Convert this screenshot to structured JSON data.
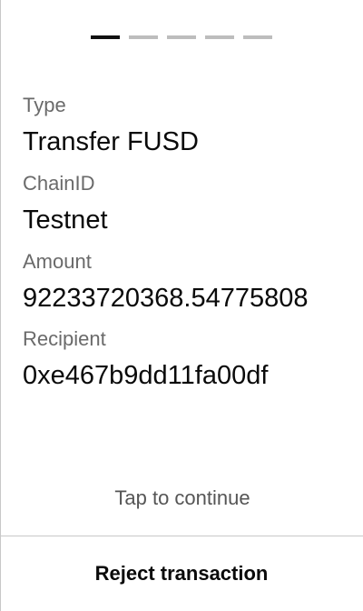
{
  "pager": {
    "total_steps": 5,
    "active_step": 1
  },
  "fields": {
    "type": {
      "label": "Type",
      "value": "Transfer FUSD"
    },
    "chain": {
      "label": "ChainID",
      "value": "Testnet"
    },
    "amount": {
      "label": "Amount",
      "value": "92233720368.54775808"
    },
    "recipient": {
      "label": "Recipient",
      "value": "0xe467b9dd11fa00df"
    }
  },
  "hint": "Tap to continue",
  "actions": {
    "reject_label": "Reject transaction"
  },
  "colors": {
    "active_step": "#111111",
    "inactive_step": "#bdbdbd",
    "label_text": "#6a6a6a",
    "divider": "#c8c8c8"
  }
}
